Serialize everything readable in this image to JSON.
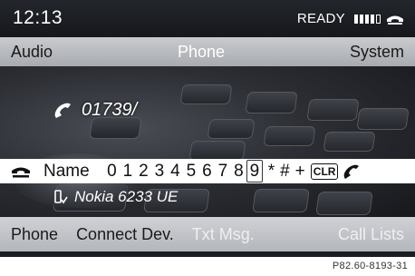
{
  "status": {
    "time": "12:13",
    "status_text": "READY",
    "signal_icon": "signal-strength-icon",
    "phone_icon": "handset-icon"
  },
  "top_menu": {
    "items": [
      {
        "label": "Audio"
      },
      {
        "label": "Phone"
      },
      {
        "label": "System"
      }
    ],
    "active": "Phone"
  },
  "dialer": {
    "number": "01739/",
    "call_icon": "call-handset-icon"
  },
  "speller": {
    "hangup_icon": "end-call-icon",
    "name_label": "Name",
    "digits": [
      "0",
      "1",
      "2",
      "3",
      "4",
      "5",
      "6",
      "7",
      "8",
      "9"
    ],
    "selected": "9",
    "symbols": [
      "*",
      "#",
      "+"
    ],
    "clear_label": "CLR",
    "call_icon": "call-icon"
  },
  "device": {
    "name": "Nokia 6233 UE",
    "icon": "connected-phone-icon"
  },
  "bottom_menu": {
    "items": [
      {
        "label": "Phone"
      },
      {
        "label": "Connect Dev."
      },
      {
        "label": "Txt Msg."
      },
      {
        "label": "Call Lists"
      }
    ]
  },
  "caption": "P82.60-8193-31",
  "colors": {
    "screen_bg": "#1b1d22",
    "menu_bg": "#b3b6bb",
    "active_text": "#ffffff",
    "disabled_text": "#eeeff1"
  }
}
